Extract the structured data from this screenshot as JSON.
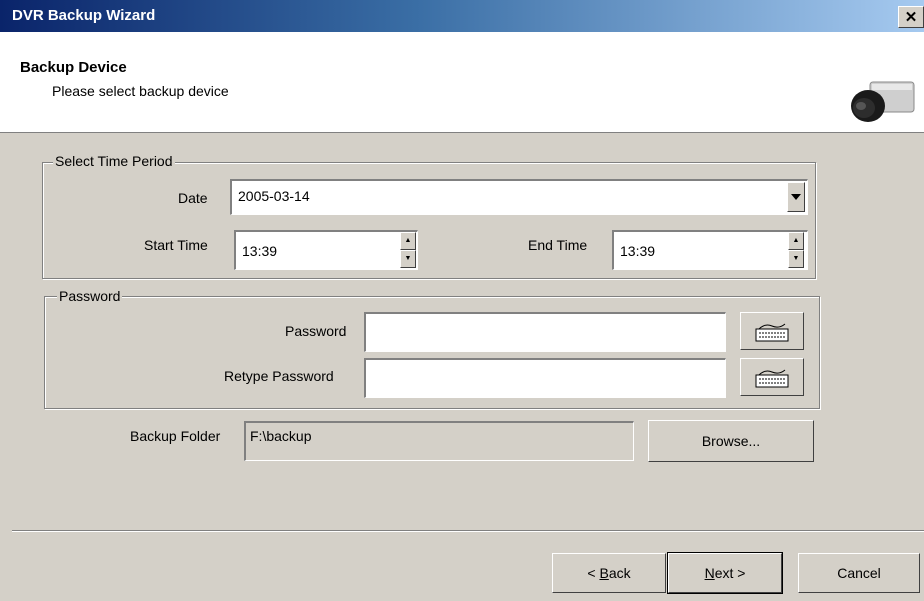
{
  "window": {
    "title": "DVR Backup Wizard",
    "close_glyph": "✕"
  },
  "header": {
    "title": "Backup Device",
    "subtitle": "Please select backup device",
    "icon": "camera-icon"
  },
  "time_period": {
    "legend": "Select Time Period",
    "date_label": "Date",
    "date_value": "2005-03-14",
    "start_label": "Start Time",
    "start_value": "13:39",
    "end_label": "End Time",
    "end_value": "13:39"
  },
  "password": {
    "legend": "Password",
    "password_label": "Password",
    "password_value": "",
    "retype_label": "Retype Password",
    "retype_value": "",
    "keyboard_icon": "keyboard-icon"
  },
  "backup": {
    "folder_label": "Backup Folder",
    "folder_value": "F:\\backup",
    "browse_label": "Browse..."
  },
  "footer": {
    "back_prefix": "< ",
    "back_mnemonic": "B",
    "back_rest": "ack",
    "next_mnemonic": "N",
    "next_rest": "ext >",
    "cancel_label": "Cancel"
  }
}
